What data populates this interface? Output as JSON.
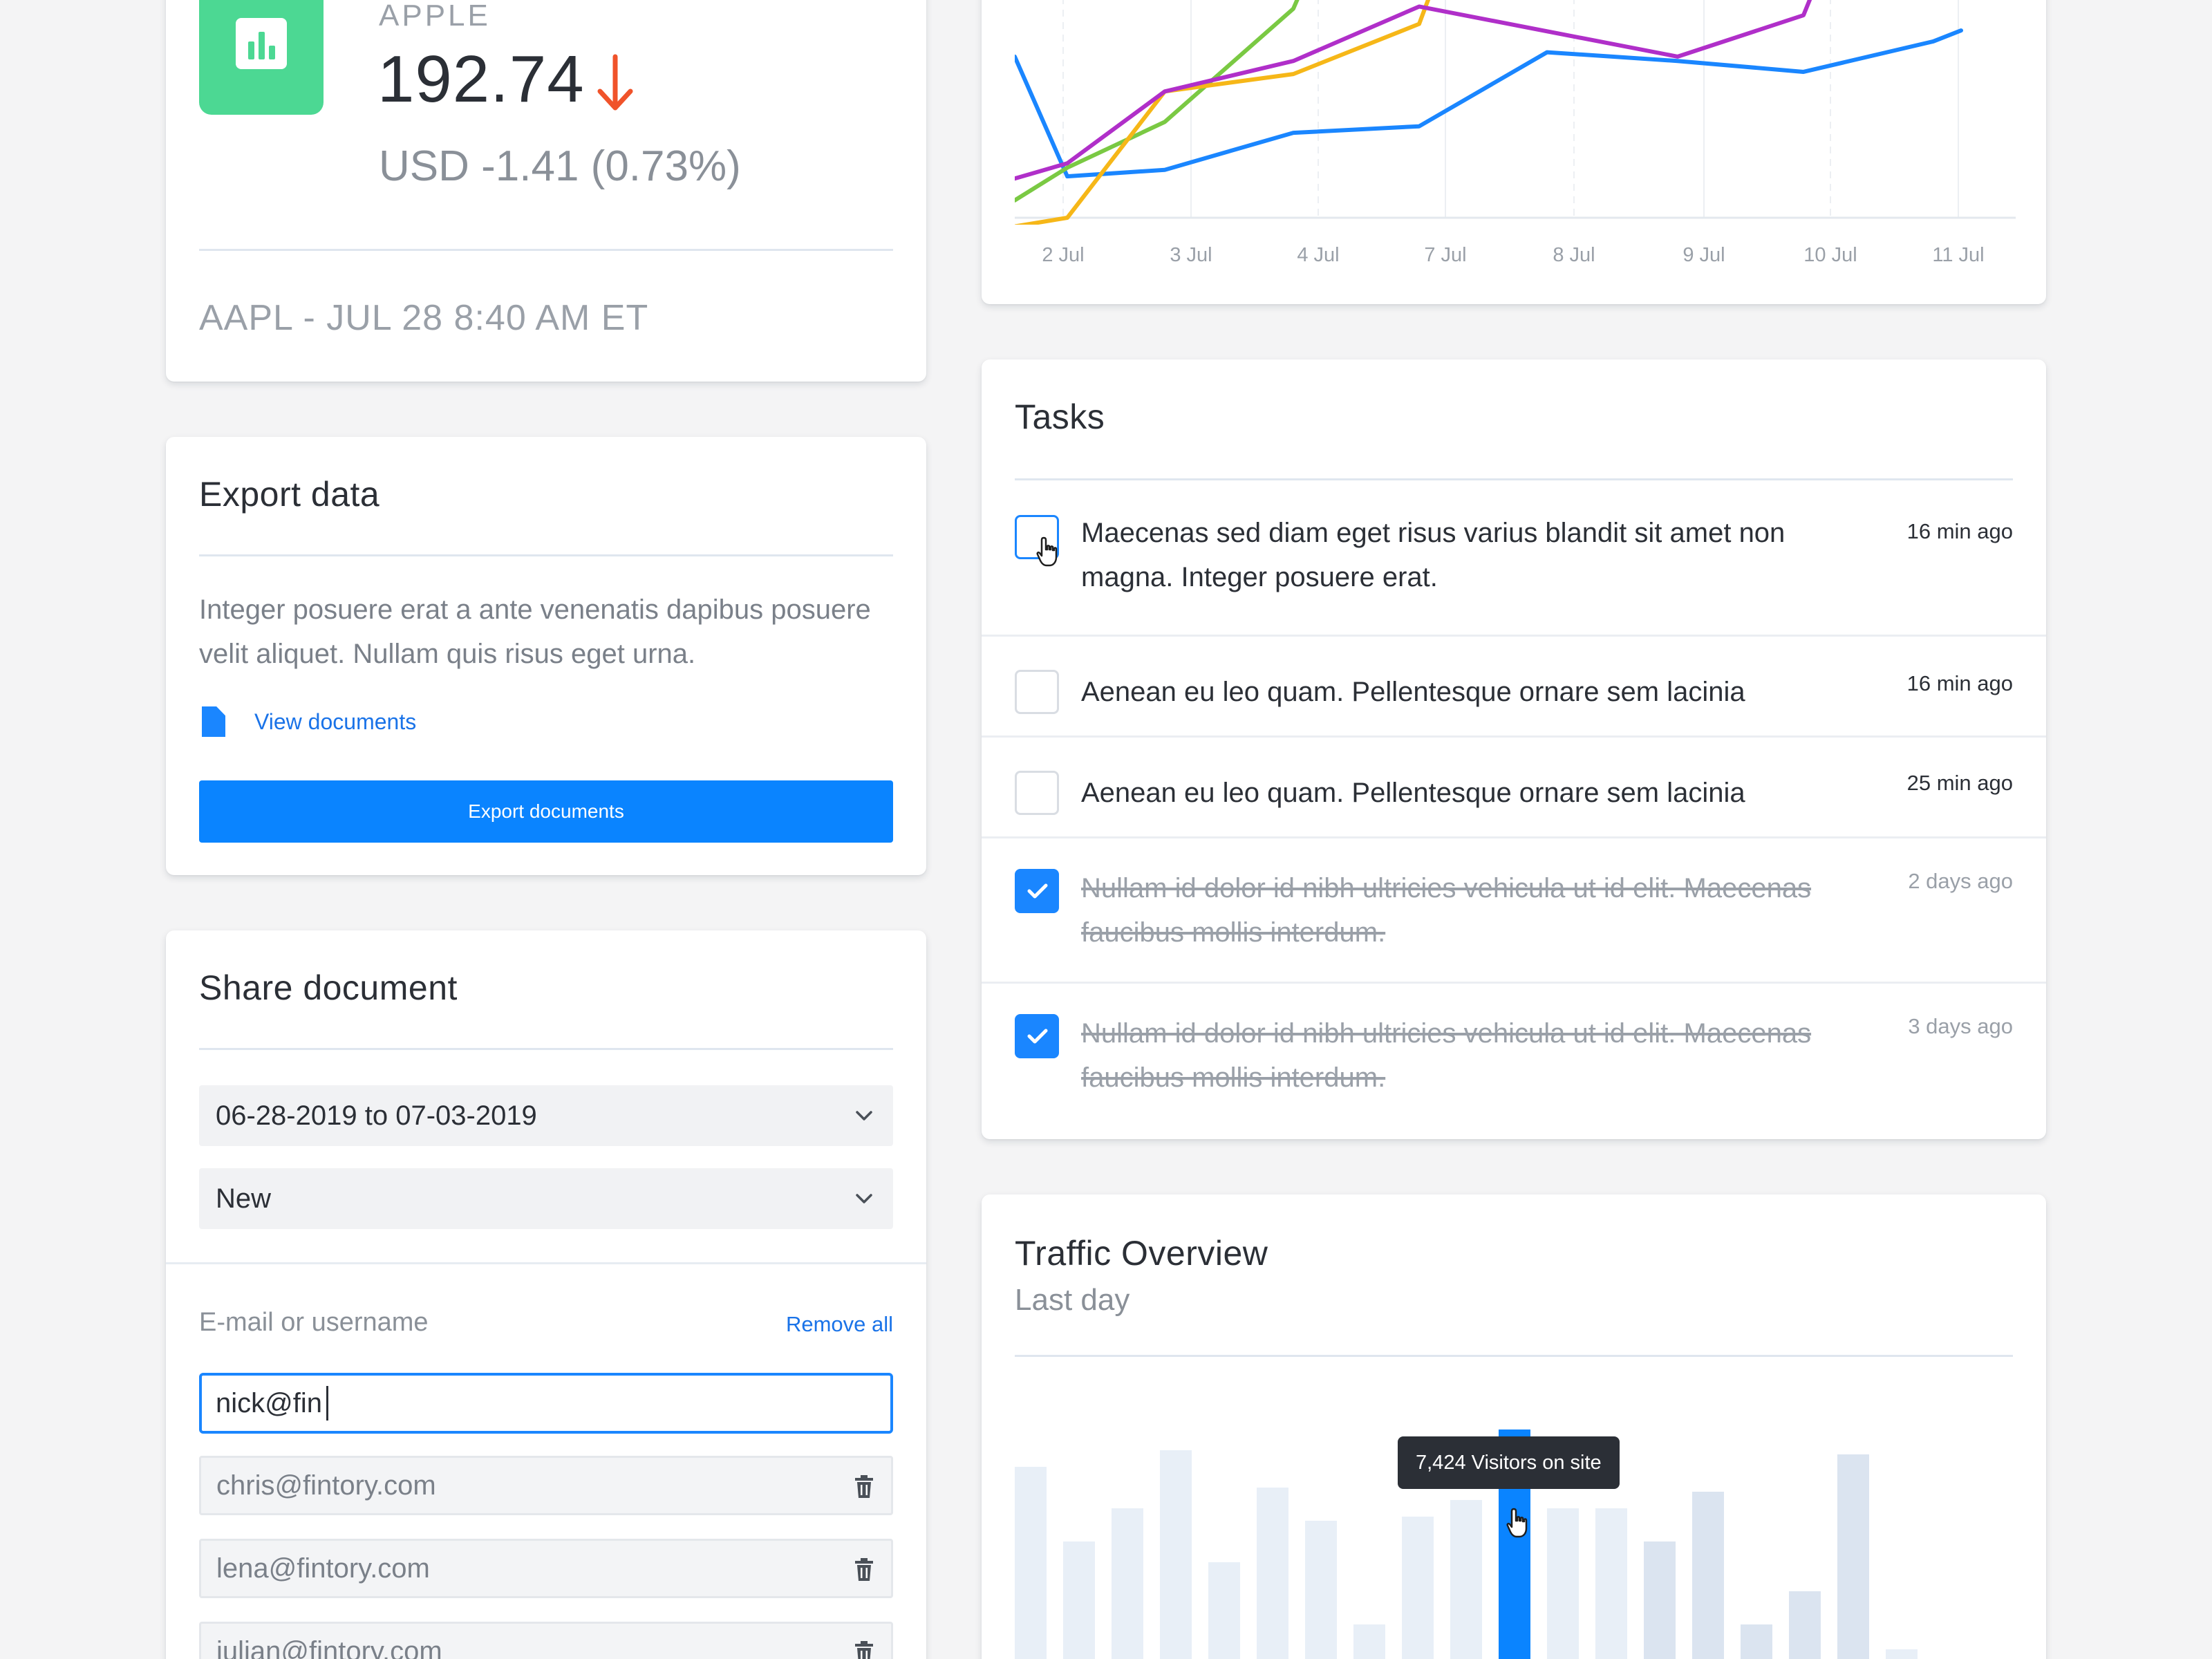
{
  "stock": {
    "company": "APPLE",
    "price": "192.74",
    "change": "USD -1.41 (0.73%)",
    "footer": "AAPL - JUL 28 8:40 AM ET",
    "icon": "bar-chart-icon",
    "arrow_icon": "arrow-down-icon",
    "colors": {
      "icon_bg": "#4cd893",
      "down": "#f0532a"
    }
  },
  "line_chart": {
    "chart_data": {
      "type": "line",
      "categories": [
        "2 Jul",
        "3 Jul",
        "4 Jul",
        "7 Jul",
        "8 Jul",
        "9 Jul",
        "10 Jul",
        "11 Jul"
      ],
      "series": [
        {
          "color": "#1a86ff",
          "values": [
            null,
            19,
            22,
            39,
            42,
            76,
            72,
            67,
            81
          ]
        },
        {
          "color": "#7ac943",
          "values": [
            null,
            23,
            44,
            96,
            null,
            null,
            null,
            null,
            null
          ]
        },
        {
          "color": "#f6b718",
          "values": [
            null,
            0,
            58,
            66,
            89,
            null,
            null,
            null,
            null
          ]
        },
        {
          "color": "#b02fc9",
          "values": [
            null,
            25,
            58,
            72,
            97,
            null,
            74,
            93,
            null
          ]
        }
      ],
      "grid": "vertical",
      "y_visible": "partial (top cropped)"
    }
  },
  "export": {
    "title": "Export data",
    "description": "Integer posuere erat a ante venenatis dapibus posuere velit aliquet. Nullam quis risus eget urna.",
    "link_icon": "document-icon",
    "link_label": "View documents",
    "button_label": "Export documents"
  },
  "share": {
    "title": "Share document",
    "date_range": "06-28-2019 to 07-03-2019",
    "status": "New",
    "field_label": "E-mail or username",
    "remove_all": "Remove all",
    "input_value": "nick@fin",
    "emails": [
      "chris@fintory.com",
      "lena@fintory.com",
      "julian@fintory.com"
    ]
  },
  "tasks": {
    "title": "Tasks",
    "items": [
      {
        "text": "Maecenas sed diam eget risus varius blandit sit amet non magna. Integer posuere erat.",
        "time": "16 min ago",
        "done": false
      },
      {
        "text": "Aenean eu leo quam. Pellentesque ornare sem lacinia",
        "time": "16 min ago",
        "done": false
      },
      {
        "text": "Aenean eu leo quam. Pellentesque ornare sem lacinia",
        "time": "25 min ago",
        "done": false
      },
      {
        "text": "Nullam id dolor id nibh ultricies vehicula ut id elit. Maecenas faucibus mollis interdum.",
        "time": "2 days ago",
        "done": true
      },
      {
        "text": "Nullam id dolor id nibh ultricies vehicula ut id elit. Maecenas faucibus mollis interdum.",
        "time": "3 days ago",
        "done": true
      }
    ]
  },
  "traffic": {
    "title": "Traffic Overview",
    "subtitle": "Last day",
    "tooltip": "7,424 Visitors on site",
    "chart_data": {
      "type": "bar",
      "values": [
        61,
        43,
        51,
        65,
        38,
        56,
        48,
        23,
        49,
        53,
        70,
        51,
        51,
        43,
        55,
        23,
        31,
        64,
        17,
        3,
        3
      ],
      "highlight_index": 10,
      "colors": {
        "bar": "#e8eff7",
        "highlight": "#0a84ff"
      },
      "note": "bars cropped at bottom edge"
    }
  }
}
